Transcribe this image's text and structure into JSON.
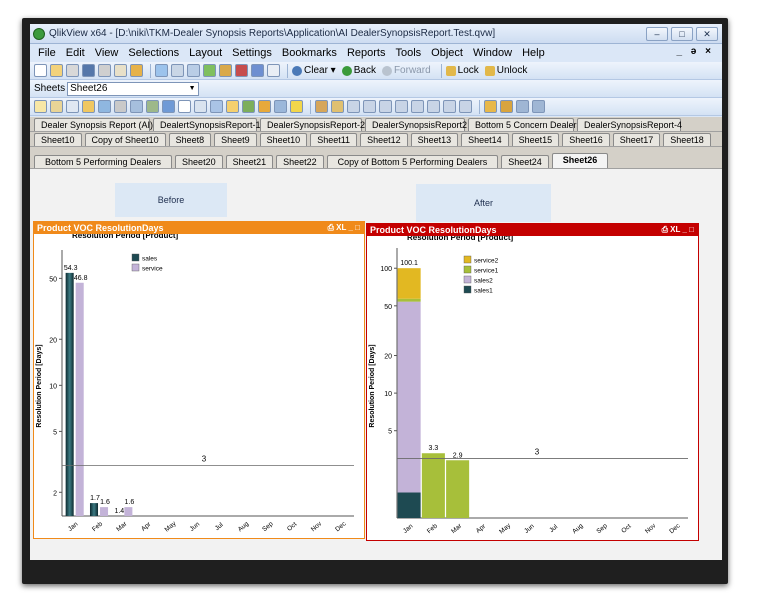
{
  "window": {
    "title": "QlikView x64 - [D:\\niki\\TKM-Dealer Synopsis Reports\\Application\\AI DealerSynopsisReport.Test.qvw]",
    "controls": [
      "‒",
      "□",
      "✕"
    ],
    "doc_controls": "_ ə ×"
  },
  "menu": [
    "File",
    "Edit",
    "View",
    "Selections",
    "Layout",
    "Settings",
    "Bookmarks",
    "Reports",
    "Tools",
    "Object",
    "Window",
    "Help"
  ],
  "toolbar": {
    "clear": "Clear",
    "back": "Back",
    "forward": "Forward",
    "lock": "Lock",
    "unlock": "Unlock"
  },
  "sheets_bar": {
    "label": "Sheets",
    "selected": "Sheet26"
  },
  "tabs": {
    "row1": [
      "Dealer Synopsis Report (AI)",
      "DealertSynopsisReport-1",
      "DealerSynopsisReport-2",
      "DealerSynopsisReport2",
      "Bottom 5 Concern Dealers",
      "DealerSynopsisReport-4"
    ],
    "row2": [
      "Sheet10",
      "Copy of Sheet10",
      "Sheet8",
      "Sheet9",
      "Sheet10",
      "Sheet11",
      "Sheet12",
      "Sheet13",
      "Sheet14",
      "Sheet15",
      "Sheet16",
      "Sheet17",
      "Sheet18"
    ],
    "row3": [
      "Bottom 5 Performing Dealers",
      "Sheet20",
      "Sheet21",
      "Sheet22",
      "Copy of Bottom 5 Performing Dealers",
      "Sheet24",
      "Sheet26"
    ],
    "active": "Sheet26"
  },
  "labels": {
    "before": "Before",
    "after": "After"
  },
  "caption_controls": "⎙ XL _ □",
  "colors": {
    "sales": "#1e4a52",
    "service": "#c3b3d8",
    "service2": "#e2b822",
    "service1": "#a7bf3a",
    "sales2": "#c3b3d8",
    "sales1": "#1e4a52",
    "before_border": "#f08a1a",
    "after_border": "#c40000"
  },
  "chart_data": [
    {
      "type": "bar",
      "caption": "Product VOC ResolutionDays",
      "title": "Resolution Period [Product]",
      "ylabel": "Resolution Period [Days]",
      "xlabel": "",
      "scale": "log",
      "ylim": [
        1.4,
        70
      ],
      "yticks": [
        2,
        5,
        10,
        20,
        50
      ],
      "categories": [
        "Jan",
        "Feb",
        "Mar",
        "Apr",
        "May",
        "Jun",
        "Jul",
        "Aug",
        "Sep",
        "Oct",
        "Nov",
        "Dec"
      ],
      "series": [
        {
          "name": "sales",
          "values": [
            54.3,
            1.7,
            1.4,
            null,
            null,
            null,
            null,
            null,
            null,
            null,
            null,
            null
          ]
        },
        {
          "name": "service",
          "values": [
            46.8,
            1.6,
            1.6,
            null,
            null,
            null,
            null,
            null,
            null,
            null,
            null,
            null
          ]
        }
      ],
      "reference_line": {
        "value": 3,
        "label": "3"
      },
      "legend": "top-center"
    },
    {
      "type": "bar",
      "stacked": true,
      "caption": "Product VOC ResolutionDays",
      "title": "Resolution Period [Product]",
      "ylabel": "Resolution Period [Days]",
      "xlabel": "",
      "scale": "log",
      "ylim": [
        1,
        130
      ],
      "yticks": [
        5,
        10,
        20,
        50,
        100
      ],
      "categories": [
        "Jan",
        "Feb",
        "Mar",
        "Apr",
        "May",
        "Jun",
        "Jul",
        "Aug",
        "Sep",
        "Oct",
        "Nov",
        "Dec"
      ],
      "series": [
        {
          "name": "sales1",
          "values": [
            1.6,
            null,
            null,
            null,
            null,
            null,
            null,
            null,
            null,
            null,
            null,
            null
          ]
        },
        {
          "name": "sales2",
          "values": [
            52.4,
            null,
            null,
            null,
            null,
            null,
            null,
            null,
            null,
            null,
            null,
            null
          ]
        },
        {
          "name": "service1",
          "values": [
            3,
            3.3,
            2.9,
            null,
            null,
            null,
            null,
            null,
            null,
            null,
            null,
            null
          ]
        },
        {
          "name": "service2",
          "values": [
            43.1,
            null,
            null,
            null,
            null,
            null,
            null,
            null,
            null,
            null,
            null,
            null
          ]
        }
      ],
      "totals": [
        "100.1",
        "3.3",
        "2.9"
      ],
      "legend_order": [
        "service2",
        "service1",
        "sales2",
        "sales1"
      ],
      "reference_line": {
        "value": 3,
        "label": "3"
      },
      "legend": "top-center"
    }
  ]
}
